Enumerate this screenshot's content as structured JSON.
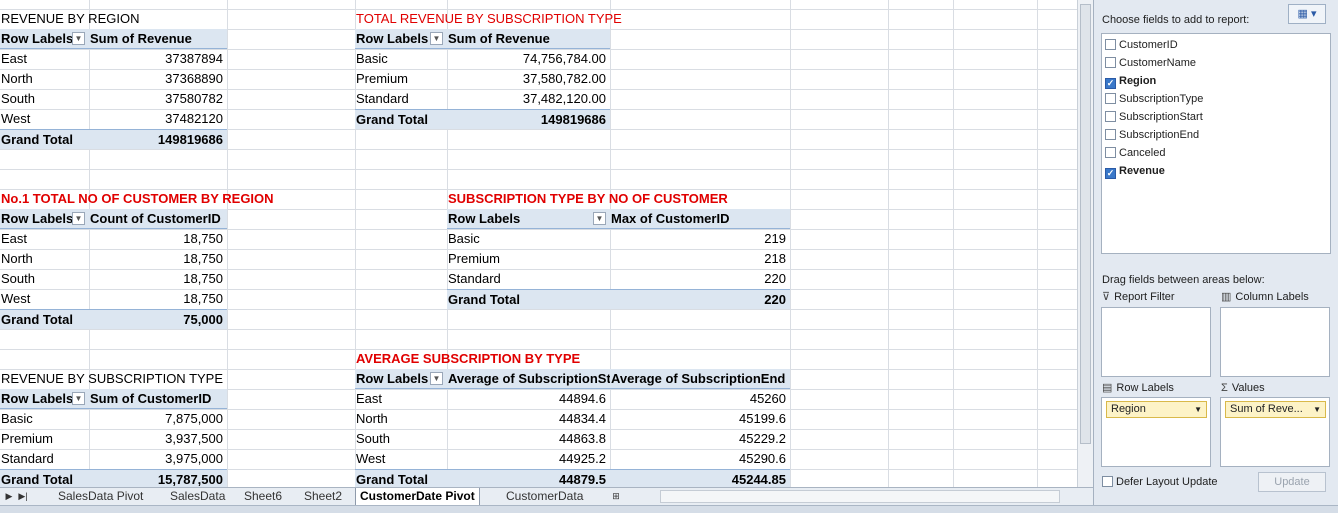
{
  "pivots": {
    "p1": {
      "title": "REVENUE BY REGION",
      "h1": "Row Labels",
      "h2": "Sum of Revenue",
      "rows": [
        [
          "East",
          "37387894"
        ],
        [
          "North",
          "37368890"
        ],
        [
          "South",
          "37580782"
        ],
        [
          "West",
          "37482120"
        ]
      ],
      "total": [
        "Grand Total",
        "149819686"
      ]
    },
    "p2": {
      "title": "TOTAL REVENUE BY SUBSCRIPTION TYPE",
      "h1": "Row Labels",
      "h2": "Sum of Revenue",
      "rows": [
        [
          "Basic",
          "74,756,784.00"
        ],
        [
          "Premium",
          "37,580,782.00"
        ],
        [
          "Standard",
          "37,482,120.00"
        ]
      ],
      "total": [
        "Grand Total",
        "149819686"
      ]
    },
    "p3": {
      "title": "No.1 TOTAL NO OF CUSTOMER BY REGION",
      "h1": "Row Labels",
      "h2": "Count of CustomerID",
      "rows": [
        [
          "East",
          "18,750"
        ],
        [
          "North",
          "18,750"
        ],
        [
          "South",
          "18,750"
        ],
        [
          "West",
          "18,750"
        ]
      ],
      "total": [
        "Grand Total",
        "75,000"
      ]
    },
    "p4": {
      "title": "SUBSCRIPTION TYPE BY NO OF CUSTOMER",
      "h1": "Row Labels",
      "h2": "Max of CustomerID",
      "rows": [
        [
          "Basic",
          "219"
        ],
        [
          "Premium",
          "218"
        ],
        [
          "Standard",
          "220"
        ]
      ],
      "total": [
        "Grand Total",
        "220"
      ]
    },
    "p5": {
      "title": "REVENUE BY SUBSCRIPTION TYPE",
      "h1": "Row Labels",
      "h2": "Sum of CustomerID",
      "rows": [
        [
          "Basic",
          "7,875,000"
        ],
        [
          "Premium",
          "3,937,500"
        ],
        [
          "Standard",
          "3,975,000"
        ]
      ],
      "total": [
        "Grand Total",
        "15,787,500"
      ]
    },
    "p6": {
      "title": "AVERAGE SUBSCRIPTION BY TYPE",
      "h1": "Row Labels",
      "h2": "Average of SubscriptionSt",
      "h3": "Average of SubscriptionEnd",
      "rows": [
        [
          "East",
          "44894.6",
          "45260"
        ],
        [
          "North",
          "44834.4",
          "45199.6"
        ],
        [
          "South",
          "44863.8",
          "45229.2"
        ],
        [
          "West",
          "44925.2",
          "45290.6"
        ]
      ],
      "total": [
        "Grand Total",
        "44879.5",
        "45244.85"
      ]
    }
  },
  "tabs": [
    "SalesData Pivot",
    "SalesData",
    "Sheet6",
    "Sheet2",
    "CustomerDate Pivot",
    "CustomerData"
  ],
  "active_tab": "CustomerDate Pivot",
  "field_list": {
    "choose_label": "Choose fields to add to report:",
    "fields": [
      {
        "name": "CustomerID",
        "checked": false
      },
      {
        "name": "CustomerName",
        "checked": false
      },
      {
        "name": "Region",
        "checked": true
      },
      {
        "name": "SubscriptionType",
        "checked": false
      },
      {
        "name": "SubscriptionStart",
        "checked": false
      },
      {
        "name": "SubscriptionEnd",
        "checked": false
      },
      {
        "name": "Canceled",
        "checked": false
      },
      {
        "name": "Revenue",
        "checked": true
      }
    ],
    "drag_label": "Drag fields between areas below:",
    "report_filter": "Report Filter",
    "column_labels": "Column Labels",
    "row_labels": "Row Labels",
    "values": "Values",
    "row_field": "Region",
    "value_field": "Sum of Reve...",
    "defer_label": "Defer Layout Update",
    "update_label": "Update"
  },
  "colors": {
    "title_red": "#e00000",
    "pivot_header": "#dce6f1",
    "checked": "#3a78c9"
  }
}
